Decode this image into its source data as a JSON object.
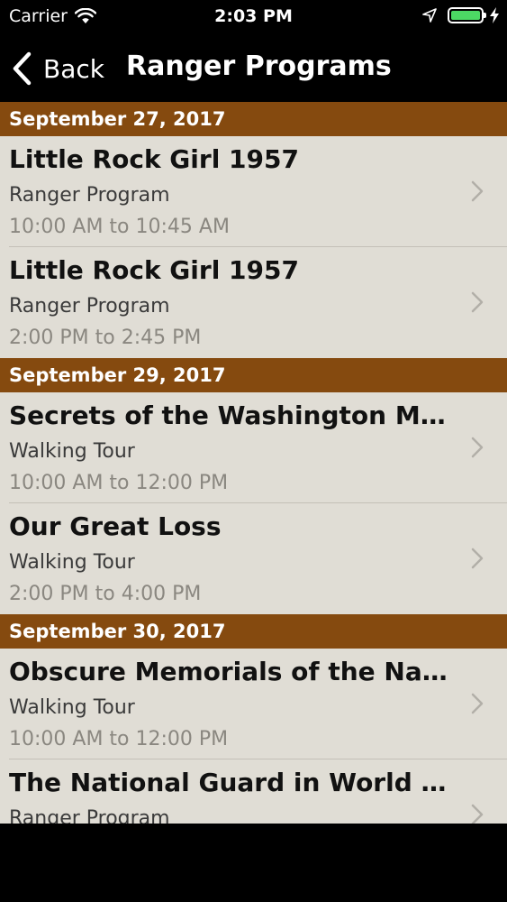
{
  "status_bar": {
    "carrier": "Carrier",
    "time": "2:03 PM",
    "battery_level": 1.0
  },
  "nav": {
    "back_label": "Back",
    "title": "Ranger Programs"
  },
  "colors": {
    "section_header": "#854a0f",
    "row_background": "#e0ddd5",
    "battery": "#4cd964"
  },
  "sections": [
    {
      "date": "September 27, 2017",
      "items": [
        {
          "title": "Little Rock Girl 1957",
          "type": "Ranger Program",
          "time": "10:00 AM to 10:45 AM"
        },
        {
          "title": "Little Rock Girl 1957",
          "type": "Ranger Program",
          "time": "2:00 PM to 2:45 PM"
        }
      ]
    },
    {
      "date": "September 29, 2017",
      "items": [
        {
          "title": "Secrets of the Washington Monument",
          "type": "Walking Tour",
          "time": "10:00 AM to 12:00 PM"
        },
        {
          "title": "Our Great Loss",
          "type": "Walking Tour",
          "time": "2:00 PM to 4:00 PM"
        }
      ]
    },
    {
      "date": "September 30, 2017",
      "items": [
        {
          "title": "Obscure Memorials of the National Mall",
          "type": "Walking Tour",
          "time": "10:00 AM to 12:00 PM"
        },
        {
          "title": "The National Guard in World War I",
          "type": "Ranger Program",
          "time": ""
        }
      ]
    }
  ]
}
